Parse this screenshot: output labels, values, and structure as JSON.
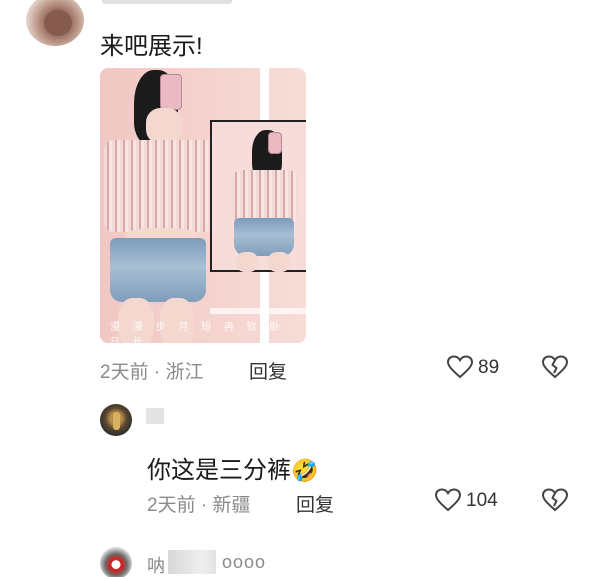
{
  "comment1": {
    "text": "来吧展示!",
    "meta": "2天前 · 浙江",
    "reply_label": "回复",
    "likes": "89",
    "photo_caption": "漫 漫 步 月 短   冉 钦 卧 日 长"
  },
  "reply1": {
    "text": "你这是三分裤",
    "emoji": "🤣",
    "meta": "2天前 · 新疆",
    "reply_label": "回复",
    "likes": "104"
  },
  "comment3": {
    "name_prefix": "呐",
    "name_suffix": "oooo"
  },
  "icons": {
    "like": "heart-outline-icon",
    "dislike": "broken-heart-icon",
    "emoji": "rolling-laughing-emoji"
  },
  "colors": {
    "meta_text": "#8a8a8a",
    "body_text": "#1a1a1a",
    "icon_stroke": "#444444"
  }
}
